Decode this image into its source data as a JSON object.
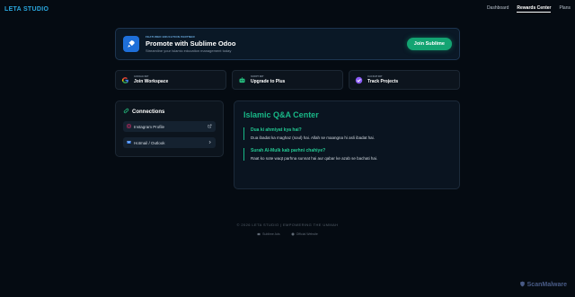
{
  "brand": "LETA STUDIO",
  "nav": [
    {
      "label": "Dashboard"
    },
    {
      "label": "Rewards Center"
    },
    {
      "label": "Plans"
    }
  ],
  "featured": {
    "tag": "FEATURED EDUCATION PARTNER",
    "title": "Promote with Sublime Odoo",
    "subtitle": "Streamline your Islamic education management today",
    "button": "Join Sublime"
  },
  "cards": [
    {
      "tag": "GOOGLE INIT",
      "title": "Join Workspace",
      "icon": "google-icon"
    },
    {
      "tag": "SCRIPT INIT",
      "title": "Upgrade to Plus",
      "icon": "robot-icon"
    },
    {
      "tag": "CLICKUP INIT",
      "title": "Track Projects",
      "icon": "clickup-icon"
    }
  ],
  "connections": {
    "title": "Connections",
    "items": [
      {
        "label": "Instagram Profile",
        "icon": "instagram-icon",
        "action": "external-link-icon"
      },
      {
        "label": "Hotmail / Outlook",
        "icon": "mail-icon",
        "action": "chevron-right-icon"
      }
    ]
  },
  "qa": {
    "title": "Islamic Q&A Center",
    "items": [
      {
        "q": "Dua ki ahmiyat kya hai?",
        "a": "Dua ibadat ka maghaz (soul) hai. Allah se maangna hi asli ibadat hai."
      },
      {
        "q": "Surah Al-Mulk kab parhni chahiye?",
        "a": "Raat ko sote waqt parhna sunnat hai aur qabar ke azab se bachati hai."
      }
    ]
  },
  "footer": {
    "copyright": "© 2026 LETA STUDIO | EMPOWERING THE UMMAH",
    "links": [
      {
        "label": "Sublime Ads"
      },
      {
        "label": "Official Website"
      }
    ]
  },
  "watermark": "ScanMalware",
  "colors": {
    "accent": "#13a472",
    "brand": "#2aa8e0",
    "background": "#050b12"
  }
}
